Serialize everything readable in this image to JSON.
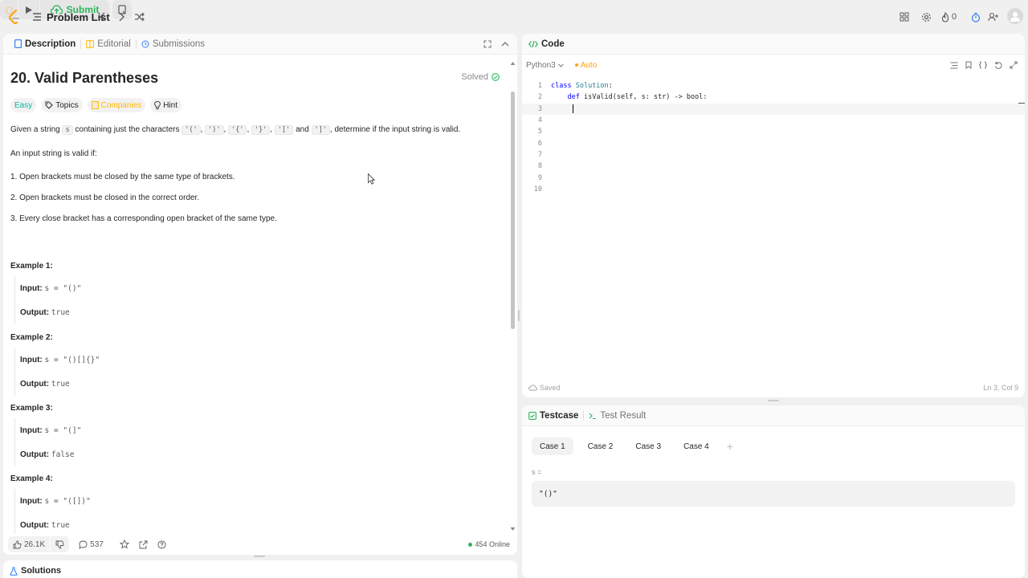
{
  "topbar": {
    "problem_list_label": "Problem List",
    "submit_label": "Submit",
    "streak_count": "0"
  },
  "description_tabs": {
    "description": "Description",
    "editorial": "Editorial",
    "submissions": "Submissions"
  },
  "problem": {
    "title": "20. Valid Parentheses",
    "status": "Solved",
    "tags": {
      "difficulty": "Easy",
      "topics": "Topics",
      "companies": "Companies",
      "hint": "Hint"
    },
    "intro_prefix": "Given a string",
    "intro_var": "s",
    "intro_mid": "containing just the characters",
    "chars": [
      "'('",
      "')'",
      "'{'",
      "'}'",
      "'['"
    ],
    "char_last": "']'",
    "and_word": "and",
    "intro_suffix": ", determine if the input string is valid.",
    "valid_if": "An input string is valid if:",
    "rules": [
      "1. Open brackets must be closed by the same type of brackets.",
      "2. Open brackets must be closed in the correct order.",
      "3. Every close bracket has a corresponding open bracket of the same type."
    ],
    "input_label": "Input:",
    "output_label": "Output:",
    "examples": [
      {
        "title": "Example 1:",
        "input": "s = \"()\"",
        "output": "true"
      },
      {
        "title": "Example 2:",
        "input": "s = \"()[]{}\"",
        "output": "true"
      },
      {
        "title": "Example 3:",
        "input": "s = \"(]\"",
        "output": "false"
      },
      {
        "title": "Example 4:",
        "input": "s = \"([])\"",
        "output": "true"
      }
    ]
  },
  "footer": {
    "likes": "26.1K",
    "comments": "537",
    "online": "454 Online"
  },
  "solutions_label": "Solutions",
  "code_panel": {
    "tab_label": "Code",
    "language": "Python3",
    "auto_label": "Auto",
    "line_numbers": [
      "1",
      "2",
      "3",
      "4",
      "5",
      "6",
      "7",
      "8",
      "9",
      "10"
    ],
    "line1_kw": "class",
    "line1_name": "Solution",
    "line1_rest": ":",
    "line2_indent": "    ",
    "line2_kw": "def",
    "line2_rest": " isValid(self, s: str) -> bool:",
    "saved": "Saved",
    "cursor_pos": "Ln 3, Col 9"
  },
  "testcase_panel": {
    "tab_testcase": "Testcase",
    "tab_result": "Test Result",
    "cases": [
      "Case 1",
      "Case 2",
      "Case 3",
      "Case 4"
    ],
    "var_label": "s =",
    "var_value": "\"()\""
  },
  "colors": {
    "accent": "#ffa116",
    "submit_green": "#2db55d",
    "easy_teal": "#00b8a3"
  }
}
